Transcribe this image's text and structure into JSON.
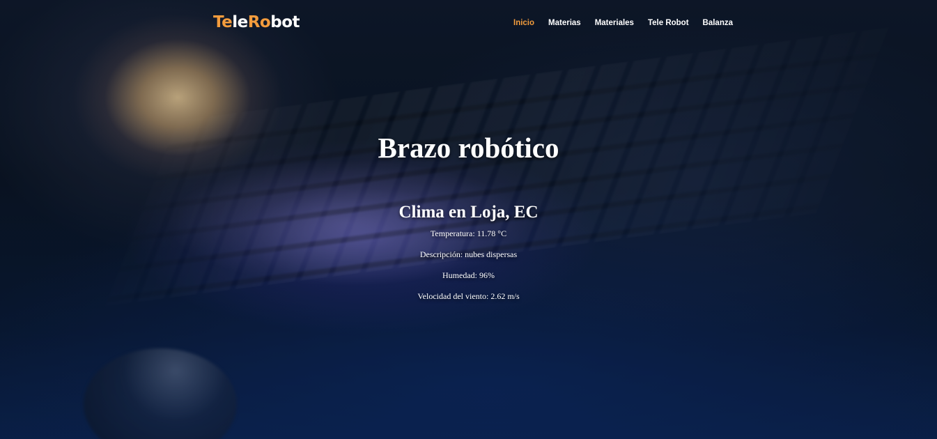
{
  "header": {
    "logo": {
      "part1": "Te",
      "part2": "le",
      "part3": "Ro",
      "part4": "bot"
    },
    "nav": [
      {
        "label": "Inicio",
        "active": true
      },
      {
        "label": "Materias",
        "active": false
      },
      {
        "label": "Materiales",
        "active": false
      },
      {
        "label": "Tele Robot",
        "active": false
      },
      {
        "label": "Balanza",
        "active": false
      }
    ]
  },
  "hero": {
    "title": "Brazo robótico"
  },
  "weather": {
    "title": "Clima en Loja, EC",
    "temperature": "Temperatura: 11.78 °C",
    "description": "Descripción: nubes dispersas",
    "humidity": "Humedad: 96%",
    "wind": "Velocidad del viento: 2.62 m/s"
  },
  "colors": {
    "accent": "#f39c3d",
    "text": "#ffffff"
  }
}
